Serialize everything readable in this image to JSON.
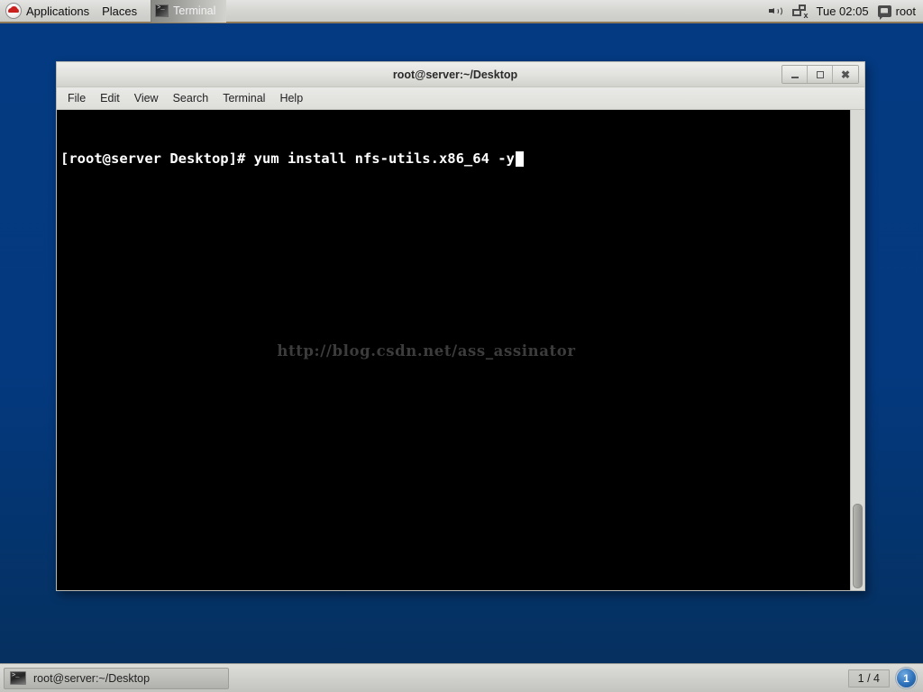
{
  "desktop": {
    "background_color": "#04397f",
    "icons": [
      {
        "name": "folder",
        "label": ""
      }
    ]
  },
  "top_panel": {
    "applications_menu": "Applications",
    "places_menu": "Places",
    "window_list": [
      {
        "label": "Terminal",
        "icon": "terminal-icon",
        "active": true
      }
    ],
    "tray": {
      "volume_icon": "volume-icon",
      "network_icon": "network-disconnected-icon",
      "clock": "Tue 02:05",
      "user_icon": "user-chat-icon",
      "user_name": "root"
    }
  },
  "terminal_window": {
    "title": "root@server:~/Desktop",
    "menu": [
      "File",
      "Edit",
      "View",
      "Search",
      "Terminal",
      "Help"
    ],
    "window_controls": {
      "minimize": "minimize-icon",
      "maximize": "maximize-icon",
      "close": "close-icon"
    },
    "content": {
      "prompt": "[root@server Desktop]# ",
      "command": "yum install nfs-utils.x86_64 -y",
      "cursor": "block",
      "foreground_color": "#ffffff",
      "background_color": "#000000"
    },
    "watermark": "http://blog.csdn.net/ass_assinator",
    "scrollbar": {
      "position": "bottom"
    }
  },
  "bottom_panel": {
    "tasks": [
      {
        "label": "root@server:~/Desktop",
        "icon": "terminal-icon",
        "active": true
      }
    ],
    "workspace": "1 / 4",
    "notification_count": "1"
  }
}
